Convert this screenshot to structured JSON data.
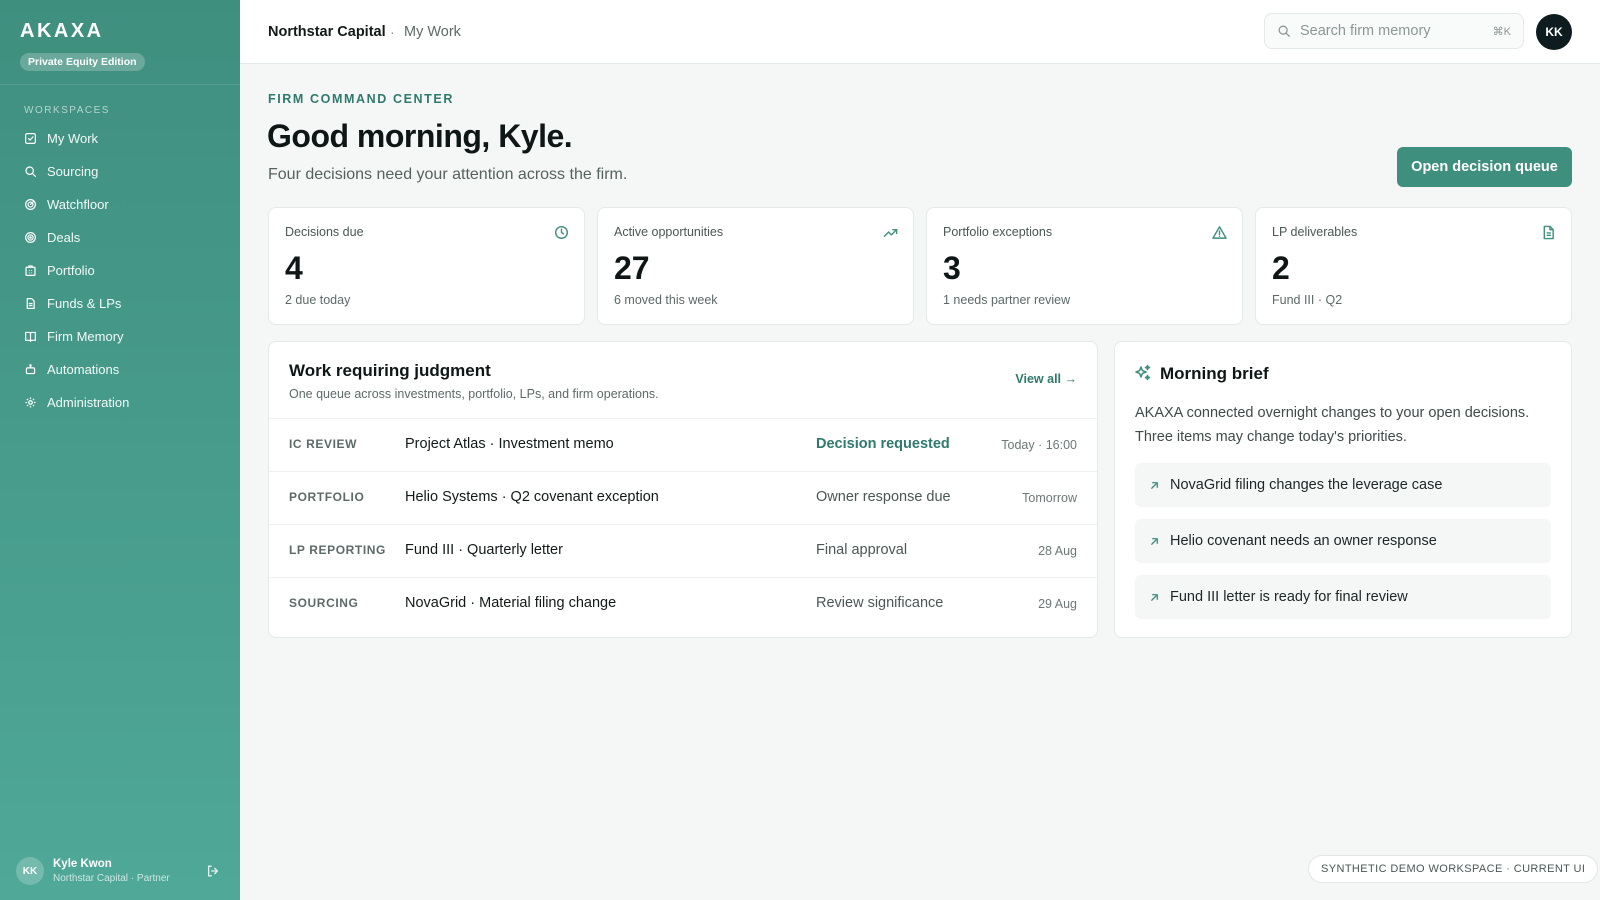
{
  "sidebar": {
    "brand": "AKAXA",
    "edition": "Private Equity Edition",
    "section_label": "WORKSPACES",
    "items": [
      {
        "label": "My Work",
        "icon": "check-square-icon"
      },
      {
        "label": "Sourcing",
        "icon": "search-icon"
      },
      {
        "label": "Watchfloor",
        "icon": "radar-icon"
      },
      {
        "label": "Deals",
        "icon": "target-icon"
      },
      {
        "label": "Portfolio",
        "icon": "building-icon"
      },
      {
        "label": "Funds & LPs",
        "icon": "document-icon"
      },
      {
        "label": "Firm Memory",
        "icon": "book-icon"
      },
      {
        "label": "Automations",
        "icon": "bot-icon"
      },
      {
        "label": "Administration",
        "icon": "gear-icon"
      }
    ],
    "user": {
      "initials": "KK",
      "name": "Kyle Kwon",
      "role": "Northstar Capital · Partner"
    }
  },
  "topbar": {
    "firm": "Northstar Capital",
    "separator": "·",
    "page": "My Work",
    "search_placeholder": "Search firm memory",
    "search_shortcut": "⌘K",
    "avatar_initials": "KK"
  },
  "header": {
    "eyebrow": "FIRM COMMAND CENTER",
    "greeting": "Good morning, Kyle.",
    "subtitle": "Four decisions need your attention across the firm.",
    "cta_label": "Open decision queue"
  },
  "metrics": [
    {
      "label": "Decisions due",
      "value": "4",
      "sub": "2 due today",
      "icon": "clock-icon"
    },
    {
      "label": "Active opportunities",
      "value": "27",
      "sub": "6 moved this week",
      "icon": "trending-up-icon"
    },
    {
      "label": "Portfolio exceptions",
      "value": "3",
      "sub": "1 needs partner review",
      "icon": "warning-icon"
    },
    {
      "label": "LP deliverables",
      "value": "2",
      "sub": "Fund III · Q2",
      "icon": "file-icon"
    }
  ],
  "queue": {
    "title": "Work requiring judgment",
    "subtitle": "One queue across investments, portfolio, LPs, and firm operations.",
    "view_all": "View all →",
    "rows": [
      {
        "category": "IC REVIEW",
        "item": "Project Atlas · Investment memo",
        "status": "Decision requested",
        "due": "Today · 16:00"
      },
      {
        "category": "PORTFOLIO",
        "item": "Helio Systems · Q2 covenant exception",
        "status": "Owner response due",
        "due": "Tomorrow"
      },
      {
        "category": "LP REPORTING",
        "item": "Fund III · Quarterly letter",
        "status": "Final approval",
        "due": "28 Aug"
      },
      {
        "category": "SOURCING",
        "item": "NovaGrid · Material filing change",
        "status": "Review significance",
        "due": "29 Aug"
      }
    ]
  },
  "brief": {
    "title": "Morning brief",
    "text": "AKAXA connected overnight changes to your open decisions. Three items may change today's priorities.",
    "items": [
      "NovaGrid filing changes the leverage case",
      "Helio covenant needs an owner response",
      "Fund III letter is ready for final review"
    ]
  },
  "footer_badge": "SYNTHETIC DEMO WORKSPACE · CURRENT UI",
  "colors": {
    "accent": "#3f8f7f",
    "accent_text": "#2f7a6c",
    "avatar_dark": "#0e1c1f"
  }
}
